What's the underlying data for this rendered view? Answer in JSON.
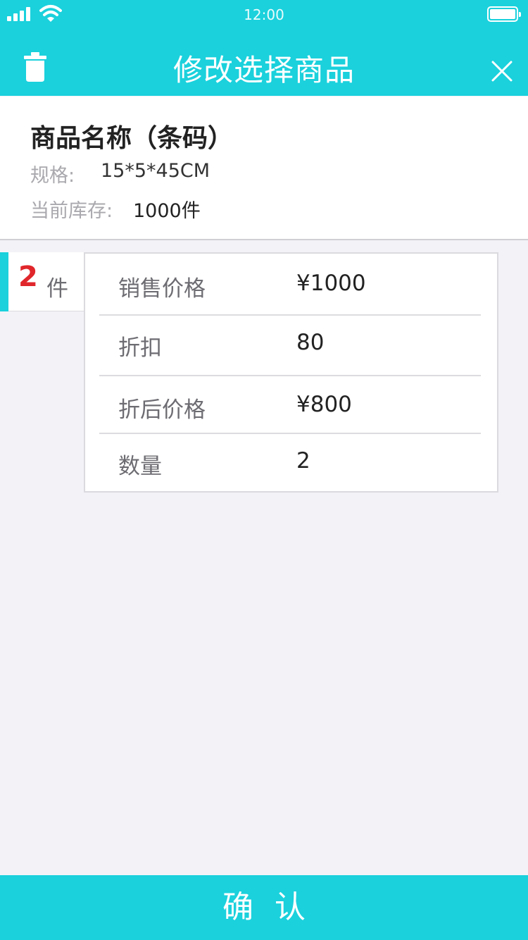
{
  "status_bar": {
    "time": "12:00"
  },
  "nav": {
    "title": "修改选择商品"
  },
  "product": {
    "name": "商品名称（条码）",
    "spec_label": "规格:",
    "spec_value": "15*5*45CM",
    "stock_label": "当前库存:",
    "stock_value": "1000件"
  },
  "quantity_tab": {
    "number": "2",
    "unit": "件"
  },
  "details": [
    {
      "label": "销售价格",
      "value": "¥1000"
    },
    {
      "label": "折扣",
      "value": "80"
    },
    {
      "label": "折后价格",
      "value": "¥800"
    },
    {
      "label": "数量",
      "value": "2"
    }
  ],
  "confirm_label": "确认",
  "colors": {
    "accent": "#1ad1dc",
    "quantity": "#e0262b",
    "background": "#f3f3f7"
  }
}
